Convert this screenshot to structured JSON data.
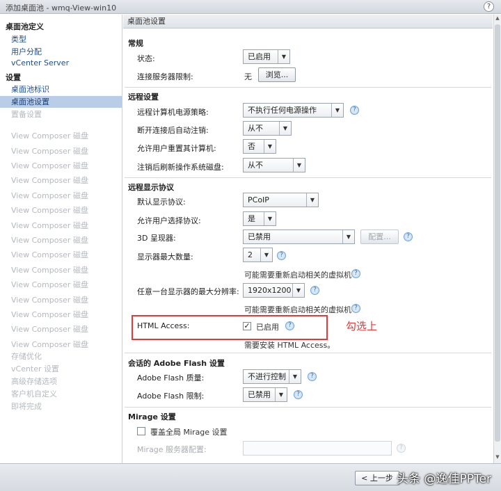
{
  "window": {
    "title": "添加桌面池 - wmq-View-win10",
    "help": "?"
  },
  "sidebar": {
    "items": [
      {
        "label": "桌面池定义",
        "kind": "head"
      },
      {
        "label": "类型",
        "kind": "sub"
      },
      {
        "label": "用户分配",
        "kind": "sub"
      },
      {
        "label": "vCenter Server",
        "kind": "sub"
      },
      {
        "label": "设置",
        "kind": "head"
      },
      {
        "label": "桌面池标识",
        "kind": "sub"
      },
      {
        "label": "桌面池设置",
        "kind": "active"
      },
      {
        "label": "置备设置",
        "kind": "dis"
      },
      {
        "label": "View Composer 磁盘",
        "kind": "dis"
      },
      {
        "label": "View Composer 磁盘",
        "kind": "dis"
      },
      {
        "label": "View Composer 磁盘",
        "kind": "dis"
      },
      {
        "label": "View Composer 磁盘",
        "kind": "dis"
      },
      {
        "label": "View Composer 磁盘",
        "kind": "dis"
      },
      {
        "label": "View Composer 磁盘",
        "kind": "dis"
      },
      {
        "label": "View Composer 磁盘",
        "kind": "dis"
      },
      {
        "label": "View Composer 磁盘",
        "kind": "dis"
      },
      {
        "label": "View Composer 磁盘",
        "kind": "dis"
      },
      {
        "label": "View Composer 磁盘",
        "kind": "dis"
      },
      {
        "label": "View Composer 磁盘",
        "kind": "dis"
      },
      {
        "label": "View Composer 磁盘",
        "kind": "dis"
      },
      {
        "label": "View Composer 磁盘",
        "kind": "dis"
      },
      {
        "label": "View Composer 磁盘",
        "kind": "dis"
      },
      {
        "label": "View Composer 磁盘",
        "kind": "dis"
      },
      {
        "label": "存储优化",
        "kind": "dis"
      },
      {
        "label": "vCenter 设置",
        "kind": "dis"
      },
      {
        "label": "高级存储选项",
        "kind": "dis"
      },
      {
        "label": "客户机自定义",
        "kind": "dis"
      },
      {
        "label": "即将完成",
        "kind": "dis"
      }
    ]
  },
  "main": {
    "header": "桌面池设置",
    "general": {
      "title": "常规",
      "state_label": "状态:",
      "state_value": "已启用",
      "conn_label": "连接服务器限制:",
      "conn_value": "无",
      "browse_button": "浏览..."
    },
    "remote": {
      "title": "远程设置",
      "power_label": "远程计算机电源策略:",
      "power_value": "不执行任何电源操作",
      "logoff_label": "断开连接后自动注销:",
      "logoff_value": "从不",
      "reset_label": "允许用户重置其计算机:",
      "reset_value": "否",
      "refresh_label": "注销后刷新操作系统磁盘:",
      "refresh_value": "从不"
    },
    "display": {
      "title": "远程显示协议",
      "default_label": "默认显示协议:",
      "default_value": "PCoIP",
      "choose_label": "允许用户选择协议:",
      "choose_value": "是",
      "renderer_label": "3D 呈现器:",
      "renderer_value": "已禁用",
      "config_button": "配置...",
      "monitors_label": "显示器最大数量:",
      "monitors_value": "2",
      "monitors_note": "可能需要重新启动相关的虚拟机",
      "resolution_label": "任意一台显示器的最大分辨率:",
      "resolution_value": "1920x1200",
      "resolution_note": "可能需要重新启动相关的虚拟机",
      "html_label": "HTML Access:",
      "html_value": "已启用",
      "html_checkmark": "✓",
      "html_note": "需要安装 HTML Access。",
      "annotation": "勾选上"
    },
    "flash": {
      "title": "会话的 Adobe Flash 设置",
      "quality_label": "Adobe Flash 质量:",
      "quality_value": "不进行控制",
      "throttle_label": "Adobe Flash 限制:",
      "throttle_value": "已禁用"
    },
    "mirage": {
      "title": "Mirage 设置",
      "override_label": "覆盖全局 Mirage 设置",
      "server_label": "Mirage 服务器配置:",
      "server_value": ""
    }
  },
  "footer": {
    "back_button": "< 上一步"
  },
  "watermark": "头条 @逸佳PPTer",
  "icons": {
    "help": "?",
    "dropdown": "▼",
    "scroll_up": "▲",
    "scroll_down": "▼"
  },
  "colors": {
    "active_nav": "#b9cde8",
    "annotation": "#e03b3b",
    "link": "#1d4e8f"
  }
}
